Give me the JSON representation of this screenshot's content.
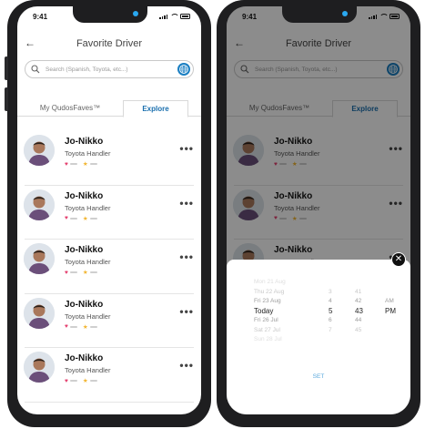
{
  "status": {
    "time": "9:41"
  },
  "header": {
    "title": "Favorite Driver"
  },
  "search": {
    "placeholder": "Search (Spanish, Toyota, etc...)"
  },
  "tabs": {
    "mine": "My QudosFaves™",
    "explore": "Explore"
  },
  "drivers": [
    {
      "name": "Jo-Nikko",
      "role": "Toyota Handler"
    },
    {
      "name": "Jo-Nikko",
      "role": "Toyota Handler"
    },
    {
      "name": "Jo-Nikko",
      "role": "Toyota Handler"
    },
    {
      "name": "Jo-Nikko",
      "role": "Toyota Handler"
    },
    {
      "name": "Jo-Nikko",
      "role": "Toyota Handler"
    }
  ],
  "picker": {
    "date": [
      "Mon 21 Aug",
      "Thu 22 Aug",
      "Fri 23 Aug",
      "Today",
      "Fri 26 Jul",
      "Sat 27 Jul",
      "Sun 28 Jul"
    ],
    "hour": [
      "3",
      "4",
      "5",
      "6",
      "7"
    ],
    "minute": [
      "41",
      "42",
      "43",
      "44",
      "45"
    ],
    "ampm": [
      "AM",
      "PM"
    ],
    "set_label": "SET"
  },
  "colors": {
    "accent": "#1a6fae",
    "heart": "#e4406f",
    "star": "#f2b531"
  }
}
